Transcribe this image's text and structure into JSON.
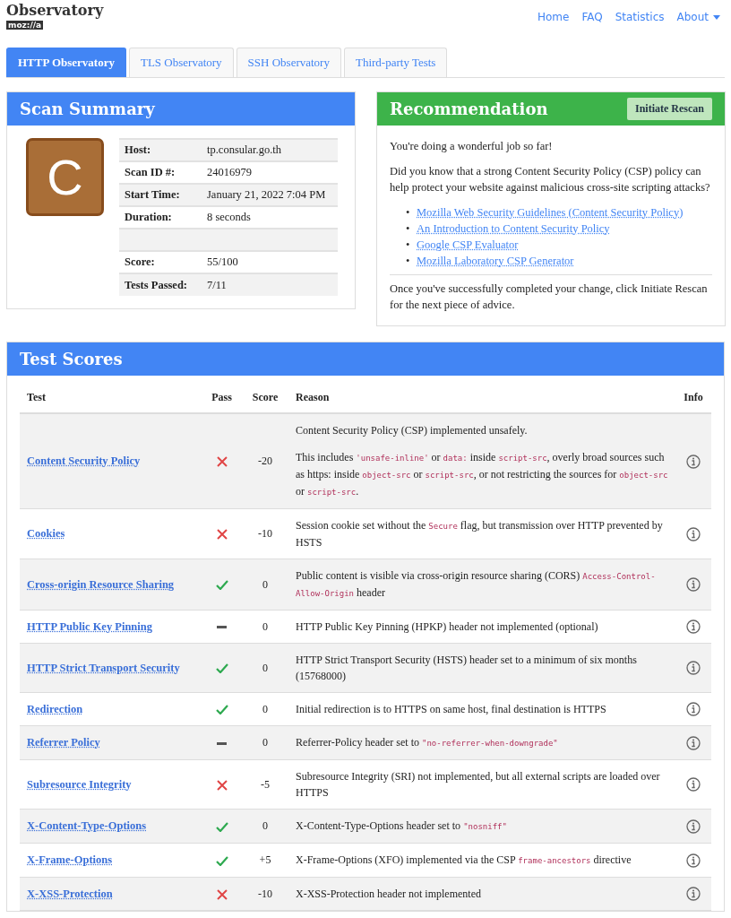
{
  "brand": {
    "title": "Observatory",
    "logo": "moz://a"
  },
  "nav": [
    {
      "label": "Home",
      "dropdown": false
    },
    {
      "label": "FAQ",
      "dropdown": false
    },
    {
      "label": "Statistics",
      "dropdown": false
    },
    {
      "label": "About",
      "dropdown": true
    }
  ],
  "tabs": [
    {
      "label": "HTTP Observatory",
      "selected": true
    },
    {
      "label": "TLS Observatory",
      "selected": false
    },
    {
      "label": "SSH Observatory",
      "selected": false
    },
    {
      "label": "Third-party Tests",
      "selected": false
    }
  ],
  "summary": {
    "title": "Scan Summary",
    "grade": "C",
    "rows": [
      {
        "kind": "field",
        "label": "Host:",
        "value": "tp.consular.go.th"
      },
      {
        "kind": "field",
        "label": "Scan ID #:",
        "value": "24016979"
      },
      {
        "kind": "field",
        "label": "Start Time:",
        "value": "January 21, 2022 7:04 PM"
      },
      {
        "kind": "field",
        "label": "Duration:",
        "value": "8 seconds"
      },
      {
        "kind": "blank"
      },
      {
        "kind": "field",
        "label": "Score:",
        "value": "55/100"
      },
      {
        "kind": "field",
        "label": "Tests Passed:",
        "value": "7/11"
      }
    ]
  },
  "recommendation": {
    "title": "Recommendation",
    "button": "Initiate Rescan",
    "intro": "You're doing a wonderful job so far!",
    "text": "Did you know that a strong Content Security Policy (CSP) policy can help protect your website against malicious cross-site scripting attacks?",
    "links": [
      {
        "bullet": "•",
        "label": "Mozilla Web Security Guidelines (Content Security Policy)"
      },
      {
        "bullet": "•",
        "label": "An Introduction to Content Security Policy"
      },
      {
        "bullet": "•",
        "label": "Google CSP Evaluator"
      },
      {
        "bullet": "•",
        "label": "Mozilla Laboratory CSP Generator"
      }
    ],
    "footer": "Once you've successfully completed your change, click Initiate Rescan for the next piece of advice."
  },
  "scores": {
    "title": "Test Scores",
    "columns": [
      "Test",
      "Pass",
      "Score",
      "Reason",
      "Info"
    ],
    "rows": [
      {
        "test": "Content Security Policy",
        "kind": "fail",
        "score": "-20",
        "reason": [
          [
            {
              "kind": "text",
              "text": "Content Security Policy (CSP) implemented unsafely."
            }
          ],
          [
            {
              "kind": "text",
              "text": "This includes "
            },
            {
              "kind": "code",
              "text": "'unsafe-inline'"
            },
            {
              "kind": "text",
              "text": " or "
            },
            {
              "kind": "code",
              "text": "data:"
            },
            {
              "kind": "text",
              "text": " inside "
            },
            {
              "kind": "code",
              "text": "script-src"
            },
            {
              "kind": "text",
              "text": ", overly broad sources such as https: inside "
            },
            {
              "kind": "code",
              "text": "object-src"
            },
            {
              "kind": "text",
              "text": " or "
            },
            {
              "kind": "code",
              "text": "script-src"
            },
            {
              "kind": "text",
              "text": ", or not restricting the sources for "
            },
            {
              "kind": "code",
              "text": "object-src"
            },
            {
              "kind": "text",
              "text": " or "
            },
            {
              "kind": "code",
              "text": "script-src"
            },
            {
              "kind": "text",
              "text": "."
            }
          ]
        ]
      },
      {
        "test": "Cookies",
        "kind": "fail",
        "score": "-10",
        "reason": [
          [
            {
              "kind": "text",
              "text": "Session cookie set without the "
            },
            {
              "kind": "code",
              "text": "Secure"
            },
            {
              "kind": "text",
              "text": " flag, but transmission over HTTP prevented by HSTS"
            }
          ]
        ]
      },
      {
        "test": "Cross-origin Resource Sharing",
        "kind": "pass",
        "score": "0",
        "reason": [
          [
            {
              "kind": "text",
              "text": "Public content is visible via cross-origin resource sharing (CORS) "
            },
            {
              "kind": "code",
              "text": "Access-Control-Allow-Origin"
            },
            {
              "kind": "text",
              "text": " header"
            }
          ]
        ]
      },
      {
        "test": "HTTP Public Key Pinning",
        "kind": "neutral",
        "score": "0",
        "reason": [
          [
            {
              "kind": "text",
              "text": "HTTP Public Key Pinning (HPKP) header not implemented (optional)"
            }
          ]
        ]
      },
      {
        "test": "HTTP Strict Transport Security",
        "kind": "pass",
        "score": "0",
        "reason": [
          [
            {
              "kind": "text",
              "text": "HTTP Strict Transport Security (HSTS) header set to a minimum of six months (15768000)"
            }
          ]
        ]
      },
      {
        "test": "Redirection",
        "kind": "pass",
        "score": "0",
        "reason": [
          [
            {
              "kind": "text",
              "text": "Initial redirection is to HTTPS on same host, final destination is HTTPS"
            }
          ]
        ]
      },
      {
        "test": "Referrer Policy",
        "kind": "neutral",
        "score": "0",
        "reason": [
          [
            {
              "kind": "text",
              "text": "Referrer-Policy header set to "
            },
            {
              "kind": "code",
              "text": "\"no-referrer-when-downgrade\""
            }
          ]
        ]
      },
      {
        "test": "Subresource Integrity",
        "kind": "fail",
        "score": "-5",
        "reason": [
          [
            {
              "kind": "text",
              "text": "Subresource Integrity (SRI) not implemented, but all external scripts are loaded over HTTPS"
            }
          ]
        ]
      },
      {
        "test": "X-Content-Type-Options",
        "kind": "pass",
        "score": "0",
        "reason": [
          [
            {
              "kind": "text",
              "text": "X-Content-Type-Options header set to "
            },
            {
              "kind": "code",
              "text": "\"nosniff\""
            }
          ]
        ]
      },
      {
        "test": "X-Frame-Options",
        "kind": "pass",
        "score": "+5",
        "reason": [
          [
            {
              "kind": "text",
              "text": "X-Frame-Options (XFO) implemented via the CSP "
            },
            {
              "kind": "code",
              "text": "frame-ancestors"
            },
            {
              "kind": "text",
              "text": " directive"
            }
          ]
        ]
      },
      {
        "test": "X-XSS-Protection",
        "kind": "fail",
        "score": "-10",
        "reason": [
          [
            {
              "kind": "text",
              "text": "X-XSS-Protection header not implemented"
            }
          ]
        ]
      }
    ]
  }
}
